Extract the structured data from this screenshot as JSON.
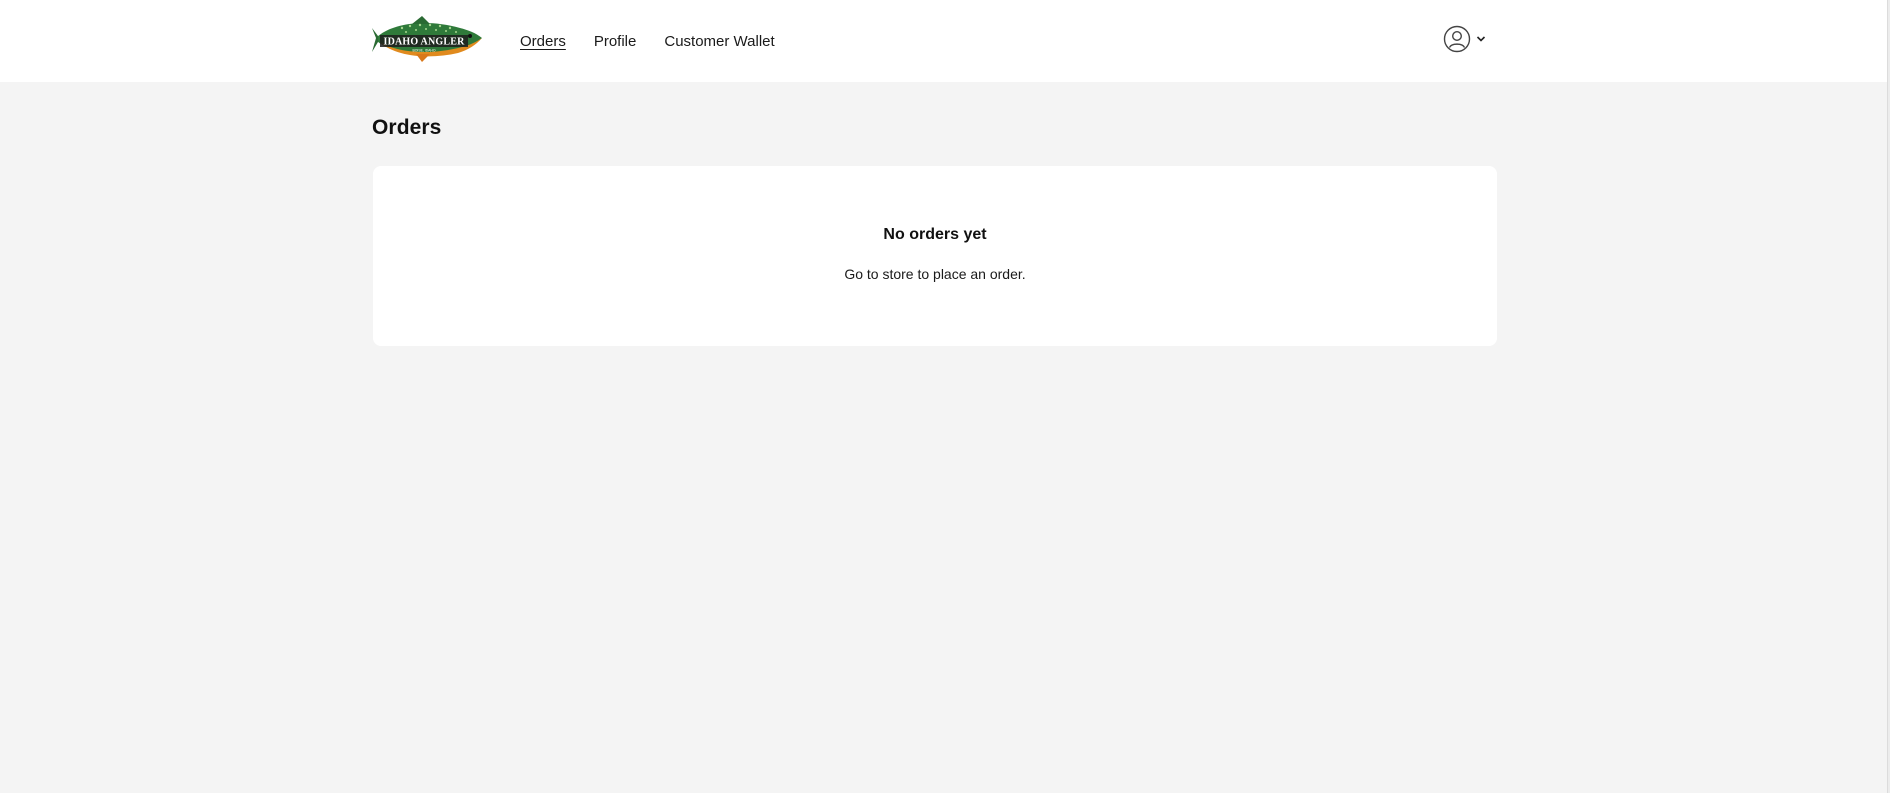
{
  "brand": {
    "logo_text": "IDAHO ANGLER",
    "logo_subtext": "BOISE, IDAHO"
  },
  "nav": {
    "items": [
      {
        "label": "Orders",
        "active": true
      },
      {
        "label": "Profile",
        "active": false
      },
      {
        "label": "Customer Wallet",
        "active": false
      }
    ]
  },
  "account": {
    "icon": "user-circle-icon",
    "chevron": "chevron-down-icon"
  },
  "page": {
    "title": "Orders"
  },
  "empty_state": {
    "title": "No orders yet",
    "message": "Go to store to place an order."
  },
  "colors": {
    "background": "#f4f4f4",
    "surface": "#ffffff",
    "text": "#1a1a1a"
  }
}
